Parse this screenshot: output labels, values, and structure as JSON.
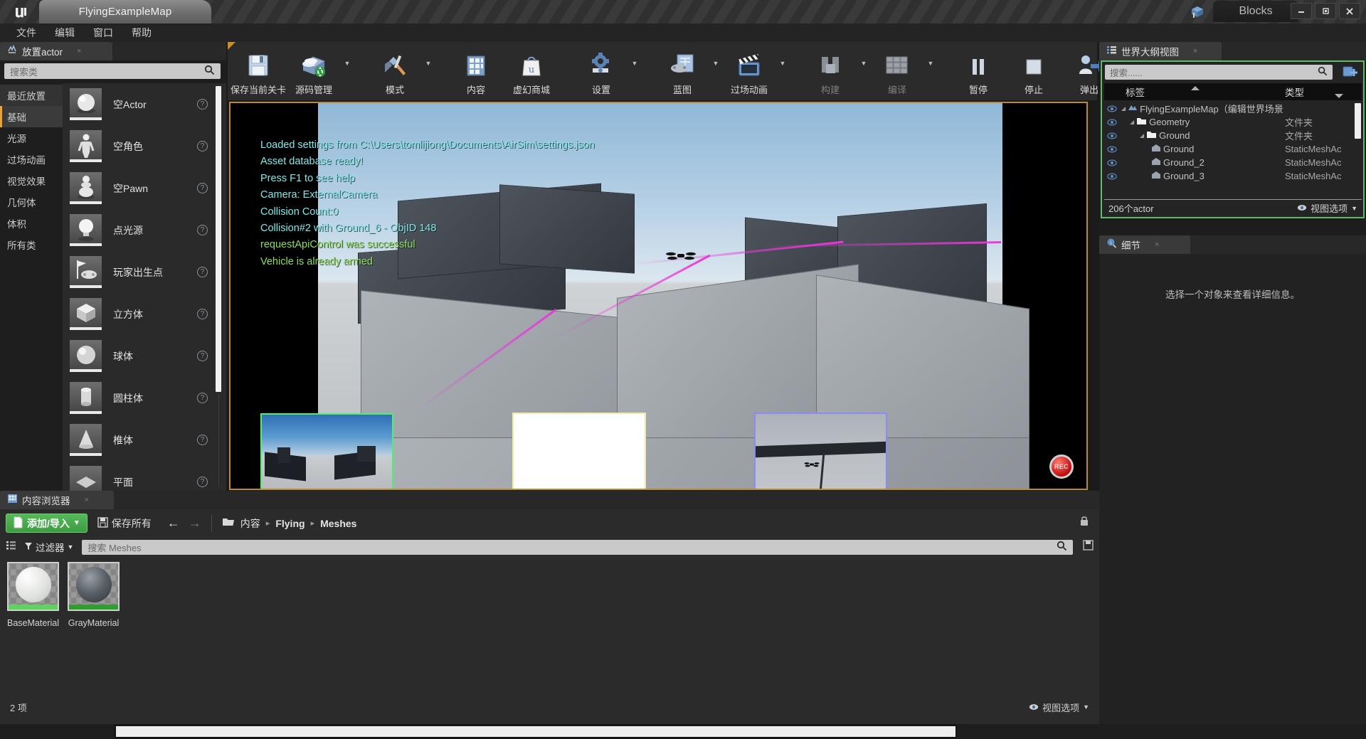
{
  "titlebar": {
    "logo": "ue-logo",
    "map_tab": "FlyingExampleMap",
    "project_tab": "Blocks",
    "minimize": "—",
    "maximize": "❐",
    "close": "✕"
  },
  "menubar": {
    "items": [
      {
        "label": "文件"
      },
      {
        "label": "编辑"
      },
      {
        "label": "窗口"
      },
      {
        "label": "帮助"
      }
    ]
  },
  "place_actors": {
    "tab_title": "放置actor",
    "close": "×",
    "search_placeholder": "搜索类",
    "categories": [
      {
        "label": "最近放置"
      },
      {
        "label": "基础"
      },
      {
        "label": "光源"
      },
      {
        "label": "过场动画"
      },
      {
        "label": "视觉效果"
      },
      {
        "label": "几何体"
      },
      {
        "label": "体积"
      },
      {
        "label": "所有类"
      }
    ],
    "selected_category": "基础",
    "actors": [
      {
        "label": "空Actor",
        "icon": "sphere-icon"
      },
      {
        "label": "空角色",
        "icon": "character-icon"
      },
      {
        "label": "空Pawn",
        "icon": "pawn-icon"
      },
      {
        "label": "点光源",
        "icon": "bulb-icon"
      },
      {
        "label": "玩家出生点",
        "icon": "playerstart-icon"
      },
      {
        "label": "立方体",
        "icon": "cube-icon"
      },
      {
        "label": "球体",
        "icon": "sphere-icon"
      },
      {
        "label": "圆柱体",
        "icon": "cylinder-icon"
      },
      {
        "label": "椎体",
        "icon": "cone-icon"
      },
      {
        "label": "平面",
        "icon": "plane-icon"
      }
    ],
    "help_glyph": "?"
  },
  "toolbar": {
    "groups": [
      {
        "buttons": [
          {
            "label": "保存当前关卡",
            "icon": "save-icon",
            "caret": false,
            "dim": false
          },
          {
            "label": "源码管理",
            "icon": "source-control-icon",
            "caret": true,
            "dim": false
          }
        ]
      },
      {
        "buttons": [
          {
            "label": "模式",
            "icon": "modes-icon",
            "caret": true,
            "dim": false
          }
        ]
      },
      {
        "buttons": [
          {
            "label": "内容",
            "icon": "content-icon",
            "caret": false,
            "dim": false
          },
          {
            "label": "虚幻商城",
            "icon": "marketplace-icon",
            "caret": false,
            "dim": false
          }
        ]
      },
      {
        "buttons": [
          {
            "label": "设置",
            "icon": "settings-gear-icon",
            "caret": true,
            "dim": false
          }
        ]
      },
      {
        "buttons": [
          {
            "label": "蓝图",
            "icon": "blueprint-icon",
            "caret": true,
            "dim": false
          },
          {
            "label": "过场动画",
            "icon": "cinematics-icon",
            "caret": true,
            "dim": false
          }
        ]
      },
      {
        "buttons": [
          {
            "label": "构建",
            "icon": "build-icon",
            "caret": true,
            "dim": true
          },
          {
            "label": "编译",
            "icon": "compile-icon",
            "caret": true,
            "dim": true
          }
        ]
      },
      {
        "buttons": [
          {
            "label": "暂停",
            "icon": "pause-icon",
            "caret": false,
            "dim": false
          },
          {
            "label": "停止",
            "icon": "stop-icon",
            "caret": false,
            "dim": false
          },
          {
            "label": "弹出",
            "icon": "eject-icon",
            "caret": false,
            "dim": false
          }
        ]
      }
    ]
  },
  "viewport": {
    "console_lines": [
      {
        "text": "Loaded settings from C:\\Users\\tomlijiong\\Documents\\AirSim\\settings.json",
        "color": "cyan"
      },
      {
        "text": "Asset database ready!",
        "color": "cyan"
      },
      {
        "text": "Press F1 to see help",
        "color": "cyan"
      },
      {
        "text": "Camera: ExternalCamera",
        "color": "cyan"
      },
      {
        "text": "Collision Count:0",
        "color": "cyan"
      },
      {
        "text": "Collision#2 with Ground_6 - ObjID 148",
        "color": "cyan"
      },
      {
        "text": "requestApiControl was successful",
        "color": "green"
      },
      {
        "text": "Vehicle is already armed",
        "color": "green"
      }
    ],
    "rec_label": "REC",
    "pip_border_colors": {
      "scene_view": "#4bf06b",
      "depth_view": "#f0eaa6",
      "segmentation_view": "#8a8cf4"
    },
    "border_color": "#bb8b28",
    "trail_color": "#e938d9"
  },
  "world_outliner": {
    "tab_title": "世界大纲视图",
    "close": "×",
    "search_placeholder": "搜索......",
    "columns": {
      "label": "标签",
      "type": "类型"
    },
    "rows": [
      {
        "name": "FlyingExampleMap（编辑世界场景",
        "type": "",
        "depth": 0,
        "icon": "map-icon",
        "expanded": true
      },
      {
        "name": "Geometry",
        "type": "文件夹",
        "depth": 1,
        "icon": "folder-icon",
        "expanded": true
      },
      {
        "name": "Ground",
        "type": "文件夹",
        "depth": 2,
        "icon": "folder-icon",
        "expanded": true
      },
      {
        "name": "Ground",
        "type": "StaticMeshAc",
        "depth": 3,
        "icon": "mesh-icon",
        "expanded": false
      },
      {
        "name": "Ground_2",
        "type": "StaticMeshAc",
        "depth": 3,
        "icon": "mesh-icon",
        "expanded": false
      },
      {
        "name": "Ground_3",
        "type": "StaticMeshAc",
        "depth": 3,
        "icon": "mesh-icon",
        "expanded": false
      }
    ],
    "actor_count": "206个actor",
    "view_options": "视图选项",
    "highlight_color": "#5fbd63"
  },
  "details": {
    "tab_title": "细节",
    "close": "×",
    "empty_message": "选择一个对象来查看详细信息。"
  },
  "content_browser": {
    "tab_title": "内容浏览器",
    "close": "×",
    "add_import": "添加/导入",
    "add_import_caret": "▾",
    "save_all": "保存所有",
    "back_arrow": "←",
    "forward_arrow": "→",
    "breadcrumbs": [
      {
        "label": "内容",
        "bold": false
      },
      {
        "label": "Flying",
        "bold": true
      },
      {
        "label": "Meshes",
        "bold": true
      }
    ],
    "crumb_sep": "▸",
    "filter_label": "过滤器",
    "filter_caret": "▾",
    "search_placeholder": "搜索 Meshes",
    "assets": [
      {
        "name": "BaseMaterial",
        "ball_color": "#f2f3f1",
        "bar_color": "#5fd35f"
      },
      {
        "name": "GrayMaterial",
        "ball_color": "#4b4f55",
        "bar_color": "#2f9e2f"
      }
    ],
    "item_count": "2 项",
    "view_options": "视图选项"
  }
}
